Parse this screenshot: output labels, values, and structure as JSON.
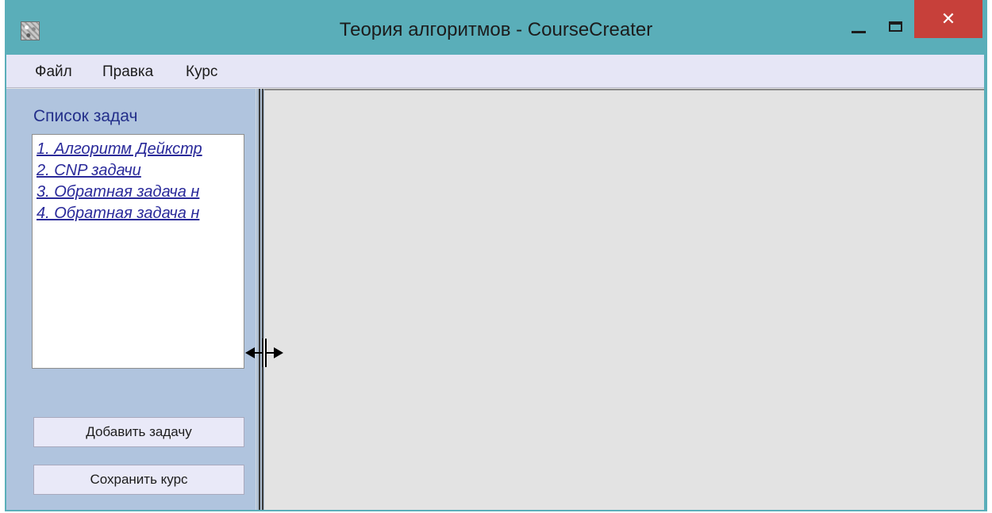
{
  "window": {
    "title": "Теория алгоритмов - CourseCreater",
    "controls": {
      "minimize": "minimize",
      "maximize": "maximize",
      "close_glyph": "✕"
    }
  },
  "menu": {
    "items": [
      {
        "label": "Файл"
      },
      {
        "label": "Правка"
      },
      {
        "label": "Курс"
      }
    ]
  },
  "left_panel": {
    "title": "Список задач",
    "tasks": [
      {
        "label": "1. Алгоритм Дейкстр"
      },
      {
        "label": "2. CNP задачи"
      },
      {
        "label": "3. Обратная задача н"
      },
      {
        "label": "4. Обратная задача н"
      }
    ],
    "add_button": "Добавить задачу",
    "save_button": "Сохранить курс"
  },
  "icons": {
    "app": "app-icon",
    "cursor": "resize-horizontal-cursor-icon"
  },
  "colors": {
    "titlebar": "#5aaeb9",
    "close_button": "#c7403a",
    "menubar": "#e6e6f6",
    "left_panel": "#b0c4de",
    "link_text": "#2a2a9a",
    "panel_title": "#232f8a",
    "main_area": "#e3e3e3"
  }
}
